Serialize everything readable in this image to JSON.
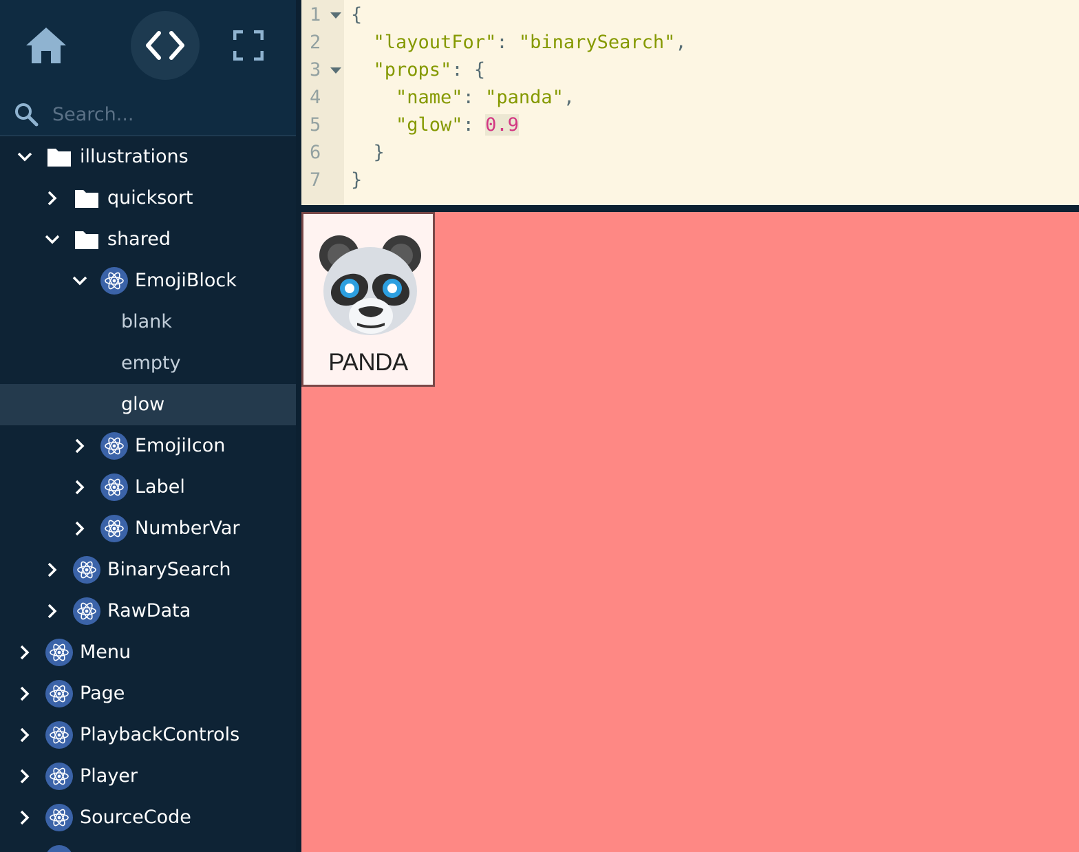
{
  "toolbar": {
    "home_icon": "home-icon",
    "code_icon": "code-brackets-icon",
    "fullscreen_icon": "fullscreen-icon"
  },
  "search": {
    "placeholder": "Search...",
    "value": ""
  },
  "tree": {
    "illustrations": "illustrations",
    "quicksort": "quicksort",
    "shared": "shared",
    "emojiblock": "EmojiBlock",
    "blank": "blank",
    "empty": "empty",
    "glow": "glow",
    "emojiicon": "EmojiIcon",
    "label": "Label",
    "numbervar": "NumberVar",
    "binarysearch": "BinarySearch",
    "rawdata": "RawData",
    "menu": "Menu",
    "page": "Page",
    "playbackcontrols": "PlaybackControls",
    "player": "Player",
    "sourcecode": "SourceCode"
  },
  "editor": {
    "line_numbers": [
      "1",
      "2",
      "3",
      "4",
      "5",
      "6",
      "7"
    ],
    "key_layoutfor": "\"layoutFor\"",
    "val_layoutfor": "\"binarySearch\"",
    "key_props": "\"props\"",
    "key_name": "\"name\"",
    "val_name": "\"panda\"",
    "key_glow": "\"glow\"",
    "val_glow": "0.9"
  },
  "preview": {
    "emoji_label": "PANDA",
    "background": "#fe8884"
  },
  "colors": {
    "sidebar_bg": "#0e2335",
    "selected_row": "#243a4d",
    "react_icon_bg": "#3b63a8",
    "editor_bg": "#fdf6e3"
  }
}
